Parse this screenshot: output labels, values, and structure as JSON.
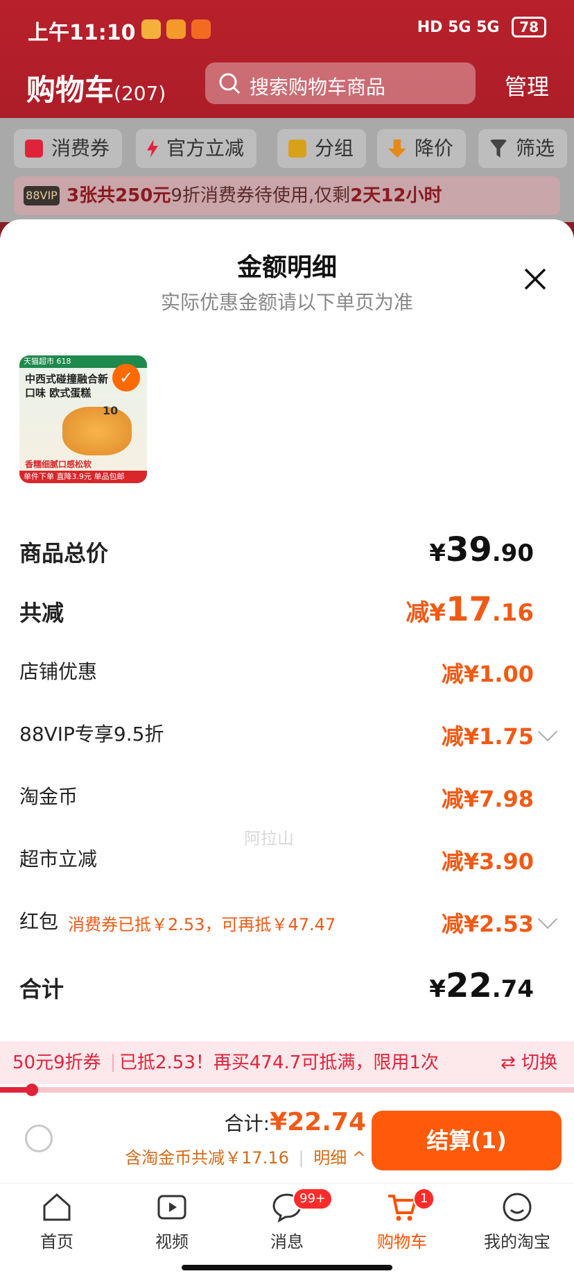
{
  "status": {
    "time": "上午11:10",
    "network": "HD 5G 5G",
    "battery": "78"
  },
  "header": {
    "title": "购物车",
    "count": "(207)",
    "search_placeholder": "搜索购物车商品",
    "manage": "管理"
  },
  "filters": [
    {
      "label": "消费券",
      "color": "#e0233a"
    },
    {
      "label": "官方立减",
      "color": "#e0233a"
    },
    {
      "label": "分组",
      "color": "#d8a11a"
    },
    {
      "label": "降价",
      "color": "#e58a15"
    },
    {
      "label": "筛选",
      "color": "#444444"
    }
  ],
  "vip_bar": {
    "badge": "88VIP",
    "text_red": "3张共250元",
    "text_mid": "9折消费券待使用,仅剩",
    "text_red2": "2天12小时",
    "text_end": "时"
  },
  "sheet": {
    "title": "金额明细",
    "subtitle": "实际优惠金额请以下单页为准",
    "watermark": "阿拉山"
  },
  "product": {
    "banner": "天猫超市 618",
    "headline": "中西式碰撞融合新口味 欧式蛋糕",
    "price_tag": "10",
    "footer": "单件下单 直降3.9元 单品包邮",
    "slogan": "香糯细腻口感松软"
  },
  "rows": {
    "total_price": {
      "label": "商品总价",
      "yen": "¥",
      "int": "39",
      "dec": ".90"
    },
    "total_discount": {
      "label": "共减",
      "prefix": "减¥",
      "int": "17",
      "dec": ".16"
    },
    "shop": {
      "label": "店铺优惠",
      "value": "减¥1.00"
    },
    "vip": {
      "label": "88VIP专享9.5折",
      "value": "减¥1.75"
    },
    "coins": {
      "label": "淘金币",
      "value": "减¥7.98"
    },
    "market": {
      "label": "超市立减",
      "value": "减¥3.90"
    },
    "redpacket": {
      "label": "红包",
      "note": "消费券已抵￥2.53，可再抵￥47.47",
      "value": "减¥2.53"
    },
    "sum": {
      "label": "合计",
      "yen": "¥",
      "int": "22",
      "dec": ".74"
    }
  },
  "coupon_bar": {
    "left": "50元9折券",
    "mid": "已抵2.53！再买474.7可抵满，限用1次",
    "switch": "⇄ 切换",
    "progress": 0.055
  },
  "checkout": {
    "total_label": "合计:",
    "total_value": "¥22.74",
    "sub": "含淘金币共减￥17.16",
    "detail": "明细 ^",
    "pay": "结算(1)"
  },
  "tabs": [
    {
      "label": "首页",
      "icon": "home-icon"
    },
    {
      "label": "视频",
      "icon": "video-icon"
    },
    {
      "label": "消息",
      "icon": "message-icon",
      "badge": "99+"
    },
    {
      "label": "购物车",
      "icon": "cart-icon",
      "badge": "1",
      "active": true
    },
    {
      "label": "我的淘宝",
      "icon": "profile-icon"
    }
  ],
  "colors": {
    "accent": "#ff5a0a",
    "discount": "#f05a16",
    "header_red": "#a21c27"
  }
}
